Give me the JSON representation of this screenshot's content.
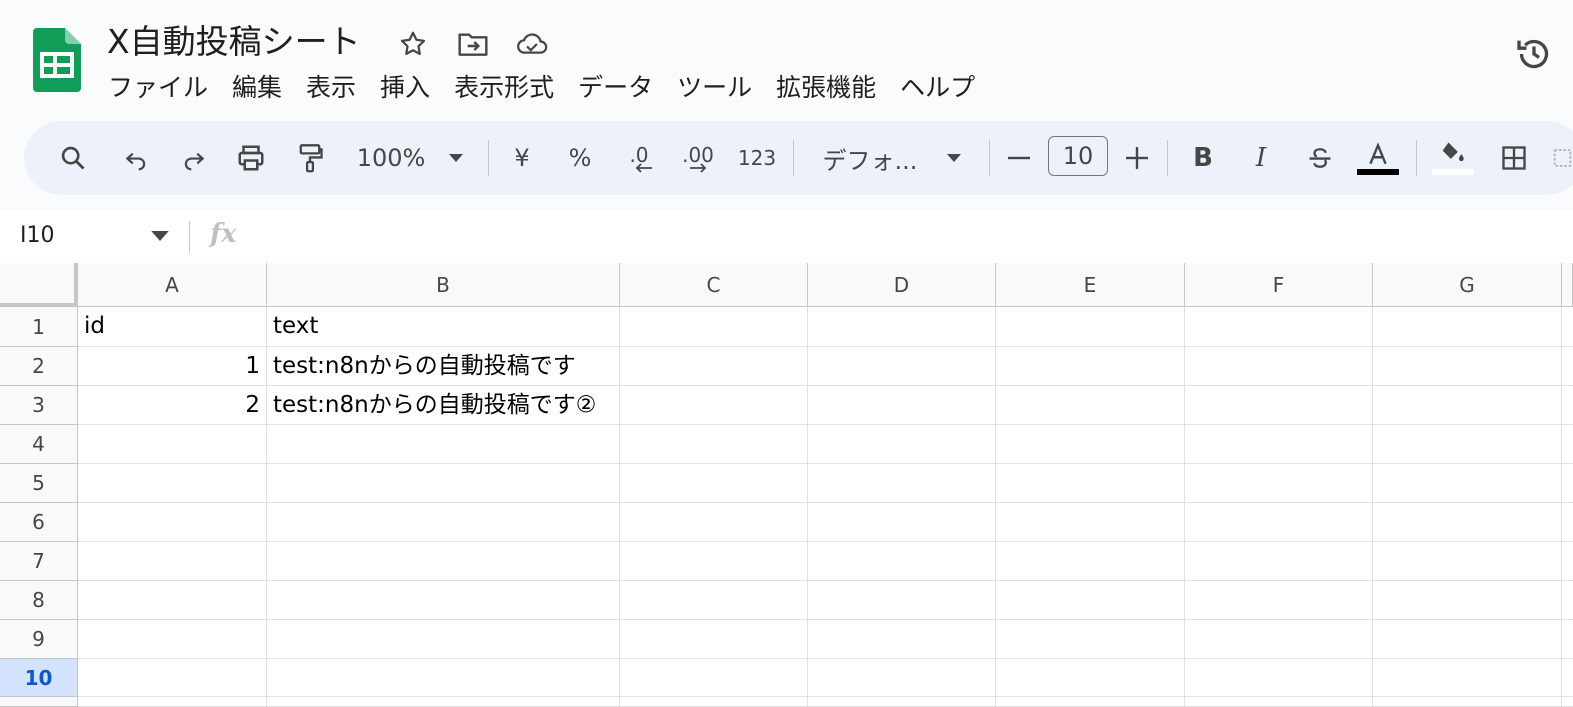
{
  "document": {
    "title": "X自動投稿シート"
  },
  "menu": [
    "ファイル",
    "編集",
    "表示",
    "挿入",
    "表示形式",
    "データ",
    "ツール",
    "拡張機能",
    "ヘルプ"
  ],
  "toolbar": {
    "zoom": "100%",
    "currency": "¥",
    "percent": "%",
    "decrease_decimal": ".0",
    "increase_decimal": ".00",
    "number_format": "123",
    "font": "デフォ...",
    "font_size": "10",
    "bold": "B",
    "italic": "I",
    "text_color": "#000000",
    "fill_color": "#ffffff"
  },
  "formula_bar": {
    "name_box": "I10",
    "fx": "fx"
  },
  "sheet": {
    "columns": [
      "A",
      "B",
      "C",
      "D",
      "E",
      "F",
      "G"
    ],
    "rows": [
      "1",
      "2",
      "3",
      "4",
      "5",
      "6",
      "7",
      "8",
      "9",
      "10"
    ],
    "selected_row": "10",
    "cells": {
      "A1": "id",
      "B1": "text",
      "A2": "1",
      "B2": "test:n8nからの自動投稿です",
      "A3": "2",
      "B3": "test:n8nからの自動投稿です②"
    }
  },
  "colors": {
    "accent": "#0b57d0",
    "sheets_green": "#0f9d58",
    "toolbar_bg": "#edf2fa",
    "selected_header": "#d3e3fd"
  }
}
